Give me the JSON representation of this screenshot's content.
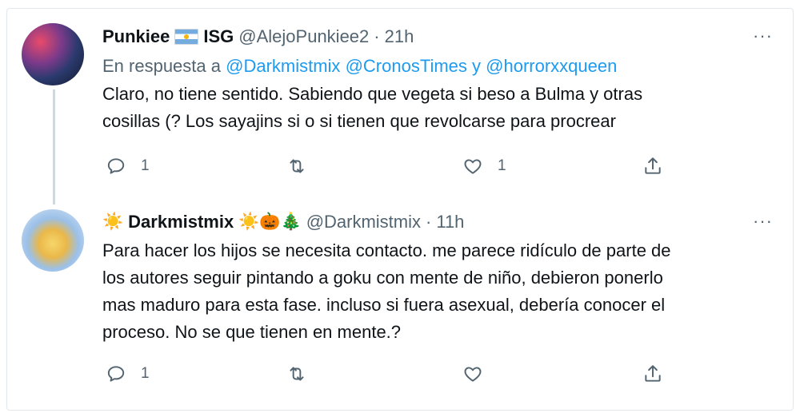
{
  "tweets": [
    {
      "name": "Punkiee",
      "flag_icon": "argentina-flag-icon",
      "name_suffix": "ISG",
      "handle": "@AlejoPunkiee2",
      "separator": "·",
      "time": "21h",
      "reply_prefix": "En respuesta a",
      "mention_1": "@Darkmistmix",
      "mention_2": "@CronosTimes",
      "reply_joiner": "y",
      "mention_3": "@horrorxxqueen",
      "text_line_1": "Claro, no tiene sentido. Sabiendo que vegeta si beso a Bulma y otras",
      "text_line_2": "cosillas (? Los sayajins si o si tienen que revolcarse para procrear",
      "reply_count": "1",
      "retweet_count": "",
      "like_count": "1",
      "more": "···"
    },
    {
      "name_prefix_emoji": "☀️",
      "name": "Darkmistmix",
      "name_suffix_emoji": "☀️🎃🎄",
      "handle": "@Darkmistmix",
      "separator": "·",
      "time": "11h",
      "text_line_1": "Para hacer los hijos se necesita contacto. me parece ridículo de parte de",
      "text_line_2": "los autores seguir pintando a goku con mente de niño, debieron ponerlo",
      "text_line_3": "mas maduro para esta fase. incluso si fuera asexual, debería conocer el",
      "text_line_4": "proceso. No se que tienen en mente.?",
      "reply_count": "1",
      "retweet_count": "",
      "like_count": "",
      "more": "···"
    }
  ],
  "colors": {
    "link": "#1d9bf0",
    "secondary_text": "#536471",
    "thread_line": "#cfd9de"
  }
}
